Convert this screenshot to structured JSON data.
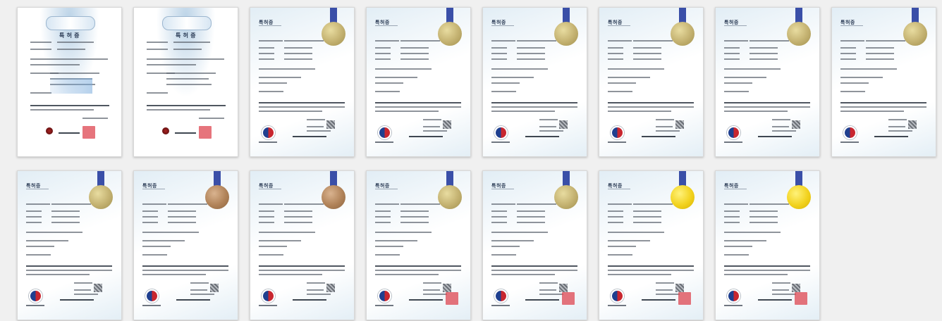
{
  "gallery": {
    "items": [
      {
        "title": "특 허 증",
        "style": "old",
        "medal": "none",
        "seal": true,
        "swatch": true
      },
      {
        "title": "특 허 증",
        "style": "old",
        "medal": "none",
        "seal": true,
        "swatch": false
      },
      {
        "title": "특허증",
        "style": "modern",
        "medal": "gold-matte",
        "seal": false,
        "swatch": false
      },
      {
        "title": "특허증",
        "style": "modern",
        "medal": "gold-matte",
        "seal": false,
        "swatch": false
      },
      {
        "title": "특허증",
        "style": "modern",
        "medal": "gold-matte",
        "seal": false,
        "swatch": false
      },
      {
        "title": "특허증",
        "style": "modern",
        "medal": "gold-matte",
        "seal": false,
        "swatch": false
      },
      {
        "title": "특허증",
        "style": "modern",
        "medal": "gold-matte",
        "seal": false,
        "swatch": false
      },
      {
        "title": "특허증",
        "style": "modern",
        "medal": "gold-matte",
        "seal": false,
        "swatch": false
      },
      {
        "title": "특허증",
        "style": "modern",
        "medal": "gold-matte",
        "seal": false,
        "swatch": false
      },
      {
        "title": "특허증",
        "style": "modern",
        "medal": "bronze",
        "seal": false,
        "swatch": false
      },
      {
        "title": "특허증",
        "style": "modern",
        "medal": "bronze",
        "seal": false,
        "swatch": false
      },
      {
        "title": "특허증",
        "style": "modern",
        "medal": "gold-matte",
        "seal": true,
        "swatch": false
      },
      {
        "title": "특허증",
        "style": "modern",
        "medal": "gold-matte",
        "seal": true,
        "swatch": false
      },
      {
        "title": "특허증",
        "style": "modern",
        "medal": "gold",
        "seal": true,
        "swatch": false
      },
      {
        "title": "특허증",
        "style": "modern",
        "medal": "gold",
        "seal": true,
        "swatch": false
      }
    ]
  },
  "colors": {
    "page_background": "#f0f0f0",
    "ribbon": "#3a4fa8",
    "seal": "#de4650"
  }
}
